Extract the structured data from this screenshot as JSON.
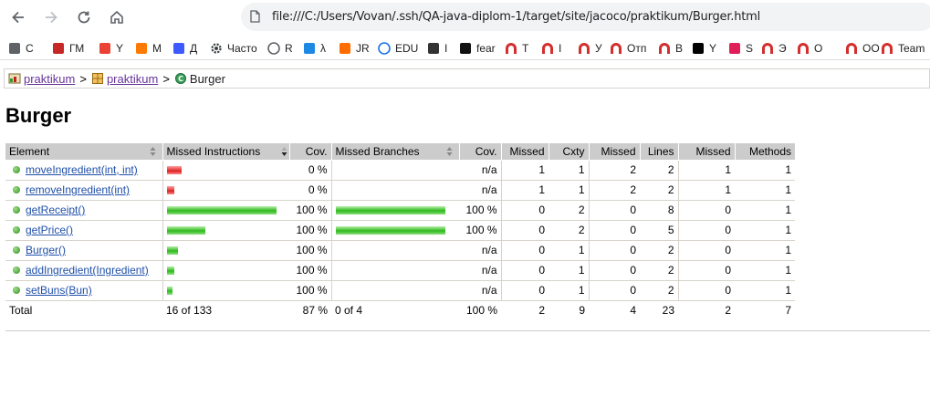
{
  "browser": {
    "url": "file:///C:/Users/Vovan/.ssh/QA-java-diplom-1/target/site/jacoco/praktikum/Burger.html"
  },
  "bookmarks": [
    {
      "label": "С",
      "icon": "folder-icon"
    },
    {
      "label": "ГМ",
      "icon": "gm-icon"
    },
    {
      "label": "Y",
      "icon": "mail-icon"
    },
    {
      "label": "М",
      "icon": "music-icon"
    },
    {
      "label": "Д",
      "icon": "disk-icon"
    },
    {
      "label": "Часто",
      "icon": "gear-icon"
    },
    {
      "label": "R",
      "icon": "globe-icon"
    },
    {
      "label": "λ",
      "icon": "lambda-icon"
    },
    {
      "label": "JR",
      "icon": "jr-icon"
    },
    {
      "label": "EDU",
      "icon": "edu-icon"
    },
    {
      "label": "I",
      "icon": "shield-icon"
    },
    {
      "label": "fear",
      "icon": "fear-icon"
    },
    {
      "label": "Т",
      "icon": "arch-icon"
    },
    {
      "label": "I",
      "icon": "arch-icon"
    },
    {
      "label": "У",
      "icon": "arch-icon"
    },
    {
      "label": "Отп",
      "icon": "arch-icon"
    },
    {
      "label": "В",
      "icon": "arch-icon"
    },
    {
      "label": "Y",
      "icon": "notion-icon"
    },
    {
      "label": "S",
      "icon": "slack-icon"
    },
    {
      "label": "Э",
      "icon": "arch-icon"
    },
    {
      "label": "О",
      "icon": "arch-icon"
    },
    {
      "label": "ОО",
      "icon": "arch-icon"
    },
    {
      "label": "Team",
      "icon": "arch-icon"
    }
  ],
  "breadcrumb": {
    "items": [
      "praktikum",
      "praktikum"
    ],
    "current": "Burger",
    "separator": ">"
  },
  "page_title": "Burger",
  "table": {
    "headers": [
      "Element",
      "Missed Instructions",
      "Cov.",
      "Missed Branches",
      "Cov.",
      "Missed",
      "Cxty",
      "Missed",
      "Lines",
      "Missed",
      "Methods"
    ],
    "rows": [
      {
        "element": "moveIngredient(int, int)",
        "instr_missed": 0.2,
        "instr_covered": 0,
        "instr_cov": "0 %",
        "branch_missed": 0,
        "branch_covered": 0,
        "branch_cov": "n/a",
        "cxty_missed": "1",
        "cxty": "1",
        "lines_missed": "2",
        "lines": "2",
        "methods_missed": "1",
        "methods": "1"
      },
      {
        "element": "removeIngredient(int)",
        "instr_missed": 0.1,
        "instr_covered": 0,
        "instr_cov": "0 %",
        "branch_missed": 0,
        "branch_covered": 0,
        "branch_cov": "n/a",
        "cxty_missed": "1",
        "cxty": "1",
        "lines_missed": "2",
        "lines": "2",
        "methods_missed": "1",
        "methods": "1"
      },
      {
        "element": "getReceipt()",
        "instr_missed": 0,
        "instr_covered": 1.0,
        "instr_cov": "100 %",
        "branch_missed": 0,
        "branch_covered": 1.0,
        "branch_cov": "100 %",
        "cxty_missed": "0",
        "cxty": "2",
        "lines_missed": "0",
        "lines": "8",
        "methods_missed": "0",
        "methods": "1"
      },
      {
        "element": "getPrice()",
        "instr_missed": 0,
        "instr_covered": 0.35,
        "instr_cov": "100 %",
        "branch_missed": 0,
        "branch_covered": 1.0,
        "branch_cov": "100 %",
        "cxty_missed": "0",
        "cxty": "2",
        "lines_missed": "0",
        "lines": "5",
        "methods_missed": "0",
        "methods": "1"
      },
      {
        "element": "Burger()",
        "instr_missed": 0,
        "instr_covered": 0.1,
        "instr_cov": "100 %",
        "branch_missed": 0,
        "branch_covered": 0,
        "branch_cov": "n/a",
        "cxty_missed": "0",
        "cxty": "1",
        "lines_missed": "0",
        "lines": "2",
        "methods_missed": "0",
        "methods": "1"
      },
      {
        "element": "addIngredient(Ingredient)",
        "instr_missed": 0,
        "instr_covered": 0.07,
        "instr_cov": "100 %",
        "branch_missed": 0,
        "branch_covered": 0,
        "branch_cov": "n/a",
        "cxty_missed": "0",
        "cxty": "1",
        "lines_missed": "0",
        "lines": "2",
        "methods_missed": "0",
        "methods": "1"
      },
      {
        "element": "setBuns(Bun)",
        "instr_missed": 0,
        "instr_covered": 0.05,
        "instr_cov": "100 %",
        "branch_missed": 0,
        "branch_covered": 0,
        "branch_cov": "n/a",
        "cxty_missed": "0",
        "cxty": "1",
        "lines_missed": "0",
        "lines": "2",
        "methods_missed": "0",
        "methods": "1"
      }
    ],
    "total": {
      "label": "Total",
      "instr": "16 of 133",
      "instr_cov": "87 %",
      "branch": "0 of 4",
      "branch_cov": "100 %",
      "cxty_missed": "2",
      "cxty": "9",
      "lines_missed": "4",
      "lines": "23",
      "methods_missed": "2",
      "methods": "7"
    }
  },
  "colors": {
    "covered": "#2fb81e",
    "missed": "#d22222",
    "header_bg": "#cccccc",
    "link": "#1f4fa8",
    "visited_link": "#663399"
  }
}
